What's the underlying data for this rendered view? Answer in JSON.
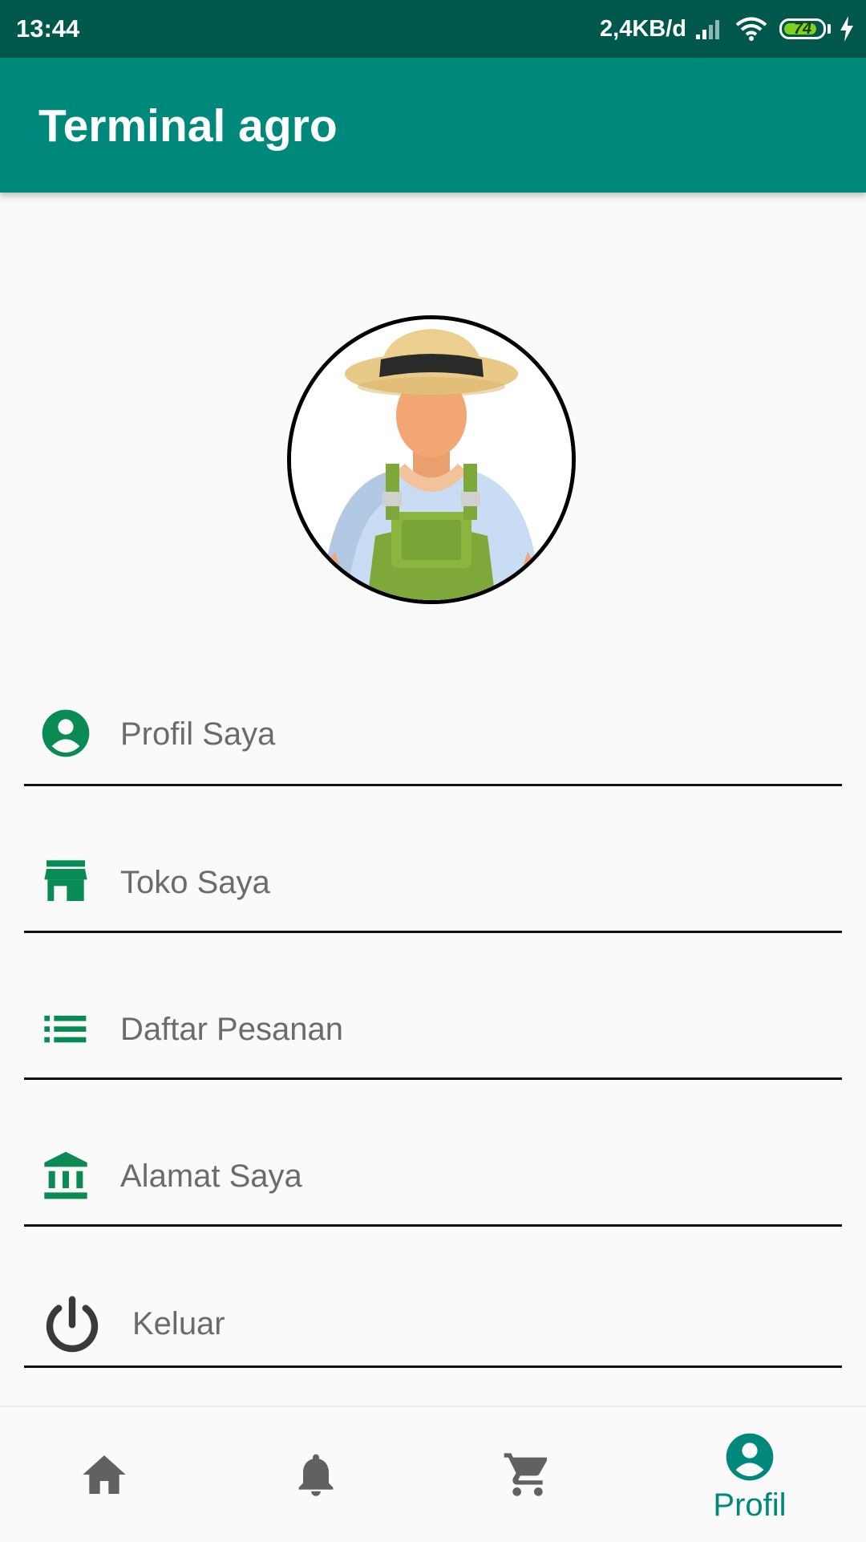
{
  "status_bar": {
    "time": "13:44",
    "network_speed": "2,4KB/d",
    "battery_level": "74"
  },
  "app_bar": {
    "title": "Terminal agro"
  },
  "menu": {
    "items": [
      {
        "label": "Profil Saya",
        "icon": "account-circle-icon"
      },
      {
        "label": "Toko Saya",
        "icon": "store-icon"
      },
      {
        "label": "Daftar Pesanan",
        "icon": "list-icon"
      },
      {
        "label": "Alamat Saya",
        "icon": "bank-icon"
      },
      {
        "label": "Keluar",
        "icon": "power-icon"
      }
    ]
  },
  "bottom_nav": {
    "items": [
      {
        "name": "home",
        "icon": "home-icon"
      },
      {
        "name": "notifications",
        "icon": "bell-icon"
      },
      {
        "name": "cart",
        "icon": "cart-icon"
      },
      {
        "name": "profile",
        "icon": "account-circle-icon",
        "label": "Profil",
        "active": true
      }
    ]
  },
  "colors": {
    "primary": "#00897b",
    "primary_dark": "#00574b",
    "icon_green": "#0a8a55",
    "text_gray": "#6b6b6b",
    "inactive_icon": "#616161"
  }
}
